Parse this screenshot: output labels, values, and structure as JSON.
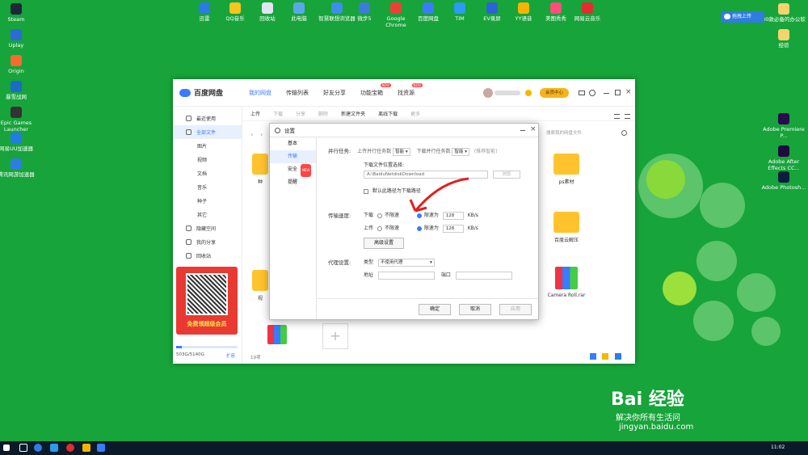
{
  "desktop": {
    "left_icons": [
      {
        "label": "Steam",
        "color": "#1b2838"
      },
      {
        "label": "Uplay",
        "color": "#2a6bd4"
      },
      {
        "label": "Origin",
        "color": "#f56c2d"
      },
      {
        "label": "暴雪战网",
        "color": "#1a6cc7"
      },
      {
        "label": "Epic Games Launcher",
        "color": "#333333"
      },
      {
        "label": "网易UU加速器",
        "color": "#1f7de3"
      },
      {
        "label": "腾讯网游加速器",
        "color": "#2f7de0"
      }
    ],
    "top_icons": [
      {
        "label": "迅雷",
        "color": "#2c7be5"
      },
      {
        "label": "QQ音乐",
        "color": "#f7c51c"
      },
      {
        "label": "回收站",
        "color": "#dfe6ee"
      },
      {
        "label": "此电脑",
        "color": "#5aa7e8"
      },
      {
        "label": "智慧联想浏览器",
        "color": "#3c8ee8"
      },
      {
        "label": "微步5",
        "color": "#3d7bd9"
      },
      {
        "label": "Google Chrome",
        "color": "#e94235"
      },
      {
        "label": "百度网盘",
        "color": "#3a7bff"
      },
      {
        "label": "TIM",
        "color": "#2b9af3"
      },
      {
        "label": "EV录屏",
        "color": "#2c64d6"
      },
      {
        "label": "YY语音",
        "color": "#f6b400"
      },
      {
        "label": "美图秀秀",
        "color": "#ff4f7b"
      },
      {
        "label": "网易云音乐",
        "color": "#e02d2d"
      }
    ],
    "right_icons": [
      {
        "label": "30款必备的办公软",
        "color": "#f5d36e"
      },
      {
        "label": "经验",
        "color": "#f5d36e"
      },
      {
        "label": "Adobe Premiere P...",
        "color": "#2a0a4f"
      },
      {
        "label": "Adobe After Effects CC...",
        "color": "#1f0a40"
      },
      {
        "label": "Adobe Photosh...",
        "color": "#0a1f3f"
      }
    ],
    "upload_button": "拖拽上传",
    "watermark_title": "Bai 经验",
    "watermark_sub": "解决你所有生活问",
    "watermark_url": "jingyan.baidu.com"
  },
  "app": {
    "title": "百度网盘",
    "tabs": [
      {
        "label": "我的网盘",
        "active": true,
        "badge": ""
      },
      {
        "label": "传输列表",
        "active": false,
        "badge": ""
      },
      {
        "label": "好友分享",
        "active": false,
        "badge": ""
      },
      {
        "label": "功能宝箱",
        "active": false,
        "badge": "NEW"
      },
      {
        "label": "找资源",
        "active": false,
        "badge": "NEW"
      }
    ],
    "vip_button": "会员中心",
    "sidebar": [
      {
        "label": "最近使用",
        "sub": false,
        "active": false
      },
      {
        "label": "全部文件",
        "sub": false,
        "active": true
      },
      {
        "label": "图片",
        "sub": true,
        "active": false
      },
      {
        "label": "视频",
        "sub": true,
        "active": false
      },
      {
        "label": "文档",
        "sub": true,
        "active": false
      },
      {
        "label": "音乐",
        "sub": true,
        "active": false
      },
      {
        "label": "种子",
        "sub": true,
        "active": false
      },
      {
        "label": "其它",
        "sub": true,
        "active": false
      },
      {
        "label": "隐藏空间",
        "sub": false,
        "active": false
      },
      {
        "label": "我的分享",
        "sub": false,
        "active": false
      },
      {
        "label": "回收站",
        "sub": false,
        "active": false
      }
    ],
    "toolbar": [
      {
        "label": "上传",
        "disabled": false
      },
      {
        "label": "下载",
        "disabled": true
      },
      {
        "label": "分享",
        "disabled": true
      },
      {
        "label": "删除",
        "disabled": true
      },
      {
        "label": "新建文件夹",
        "disabled": false
      },
      {
        "label": "离线下载",
        "disabled": false
      },
      {
        "label": "更多",
        "disabled": true
      }
    ],
    "search_placeholder": "搜索我的网盘文件",
    "promo_text": "免费领超级会员",
    "storage_text": "503G/5140G",
    "storage_fraction": 0.098,
    "expand_label": "扩容",
    "item_count": "19项",
    "files": [
      {
        "name": "ps素材",
        "type": "folder"
      },
      {
        "name": "百度云解压",
        "type": "folder"
      },
      {
        "name": "Camera Roll.rar",
        "type": "rar"
      }
    ],
    "partial_labels": [
      "种",
      "视"
    ]
  },
  "settings": {
    "title": "设置",
    "nav": [
      {
        "label": "基本",
        "active": false,
        "badge": ""
      },
      {
        "label": "传输",
        "active": true,
        "badge": ""
      },
      {
        "label": "安全",
        "active": false,
        "badge": "NEW"
      },
      {
        "label": "提醒",
        "active": false,
        "badge": ""
      }
    ],
    "parallel": {
      "label": "并行任务:",
      "upload_label": "上传并行任务数",
      "upload_value": "智能",
      "download_label": "下载并行任务数",
      "download_value": "智能",
      "hint": "(推荐智能)"
    },
    "download_path": {
      "label": "下载文件位置选择:",
      "value": "A:\\BaiduNetdiskDownload",
      "browse": "浏览",
      "default_label": "默认此路径为下载路径"
    },
    "speed": {
      "label": "传输速度:",
      "download_label": "下载",
      "upload_label": "上传",
      "unlimited": "不限速",
      "limit": "限速为",
      "download_value": "128",
      "upload_value": "128",
      "unit": "KB/s",
      "advanced": "高级设置"
    },
    "proxy": {
      "label": "代理设置:",
      "type_label": "类型",
      "type_value": "不使用代理",
      "addr_label": "地址",
      "port_label": "端口"
    },
    "ok": "确定",
    "cancel": "取消",
    "apply": "应用"
  },
  "taskbar": {
    "time": "11:02"
  }
}
